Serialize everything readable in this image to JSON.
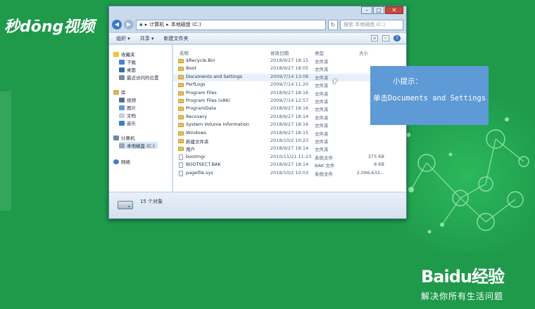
{
  "watermark": "秒dōng视频",
  "window": {
    "controls": {
      "minimize": "–",
      "maximize": "□",
      "close": "✕"
    },
    "address": {
      "parts": [
        "计算机",
        "本地磁盘 (C:)"
      ]
    },
    "search_placeholder": "搜索 本地磁盘 (C:)",
    "toolbar": {
      "organize": "组织 ▾",
      "share": "共享 ▾",
      "new_folder": "新建文件夹"
    },
    "nav": {
      "favorites": "收藏夹",
      "downloads": "下载",
      "desktop": "桌面",
      "recent": "最近访问的位置",
      "libraries": "库",
      "videos": "视频",
      "pictures": "图片",
      "documents": "文档",
      "music": "音乐",
      "computer": "计算机",
      "local_disk": "本地磁盘 (C:)",
      "network": "网络"
    },
    "columns": {
      "name": "名称",
      "date": "修改日期",
      "type": "类型",
      "size": "大小"
    },
    "files": [
      {
        "name": "$Recycle.Bin",
        "date": "2018/9/27 18:15",
        "type": "文件夹",
        "size": ""
      },
      {
        "name": "Boot",
        "date": "2018/9/27 18:05",
        "type": "文件夹",
        "size": ""
      },
      {
        "name": "Documents and Settings",
        "date": "2009/7/14 13:08",
        "type": "文件夹",
        "size": ""
      },
      {
        "name": "PerfLogs",
        "date": "2009/7/14 11:20",
        "type": "文件夹",
        "size": ""
      },
      {
        "name": "Program Files",
        "date": "2018/9/27 18:16",
        "type": "文件夹",
        "size": ""
      },
      {
        "name": "Program Files (x86)",
        "date": "2009/7/14 12:57",
        "type": "文件夹",
        "size": ""
      },
      {
        "name": "ProgramData",
        "date": "2018/9/27 18:16",
        "type": "文件夹",
        "size": ""
      },
      {
        "name": "Recovery",
        "date": "2018/9/27 18:14",
        "type": "文件夹",
        "size": ""
      },
      {
        "name": "System Volume Information",
        "date": "2018/9/27 18:16",
        "type": "文件夹",
        "size": ""
      },
      {
        "name": "Windows",
        "date": "2018/9/27 18:15",
        "type": "文件夹",
        "size": ""
      },
      {
        "name": "新建文件夹",
        "date": "2018/10/2 10:23",
        "type": "文件夹",
        "size": ""
      },
      {
        "name": "用户",
        "date": "2018/9/27 18:14",
        "type": "文件夹",
        "size": ""
      },
      {
        "name": "bootmgr",
        "date": "2010/11/21 11:23",
        "type": "系统文件",
        "size": "375 KB"
      },
      {
        "name": "BOOTSECT.BAK",
        "date": "2018/9/27 18:14",
        "type": "BAK 文件",
        "size": "8 KB"
      },
      {
        "name": "pagefile.sys",
        "date": "2018/10/2 10:03",
        "type": "系统文件",
        "size": "2,096,632..."
      }
    ],
    "status_count": "15 个对象"
  },
  "tip": {
    "title": "小提示：",
    "body": "单击Documents and Settings"
  },
  "baidu": {
    "logo_text": "Baidu经验",
    "slogan": "解决你所有生活问题"
  },
  "colors": {
    "background": "#1e9a4a",
    "tip_bg": "#5d9ad6"
  }
}
